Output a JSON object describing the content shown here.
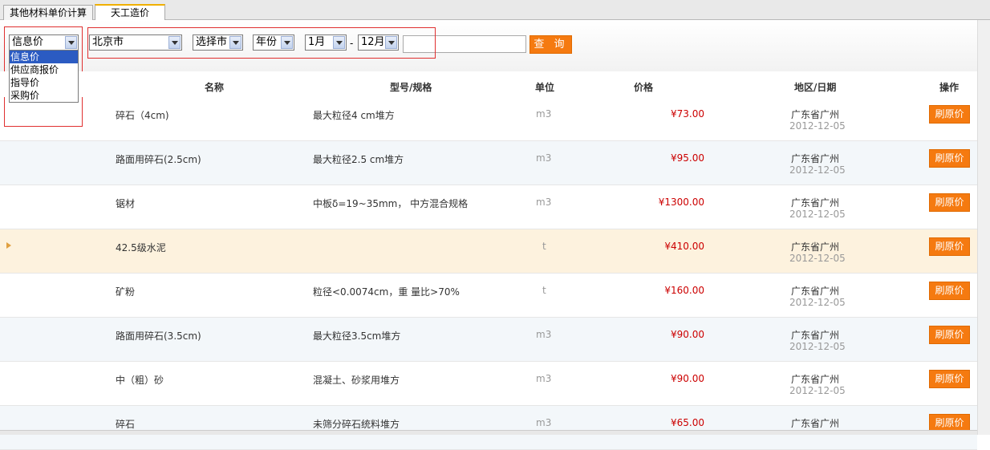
{
  "tabs": [
    {
      "label": "其他材料单价计算"
    },
    {
      "label": "天工造价"
    }
  ],
  "filters": {
    "price_type": {
      "selected": "信息价",
      "options": [
        "信息价",
        "供应商报价",
        "指导价",
        "采购价"
      ]
    },
    "province": {
      "selected": "北京市"
    },
    "city": {
      "selected": "选择市"
    },
    "year": {
      "selected": "年份"
    },
    "month_from": {
      "selected": "1月"
    },
    "month_sep": "-",
    "month_to": {
      "selected": "12月"
    },
    "keyword": {
      "value": ""
    },
    "query_label": "查 询"
  },
  "table": {
    "headers": [
      "名称",
      "型号/规格",
      "单位",
      "价格",
      "地区/日期",
      "操作"
    ],
    "rows": [
      {
        "name": "碎石（4cm)",
        "spec": "最大粒径4 cm堆方",
        "unit": "m3",
        "price": "¥73.00",
        "region": "广东省广州",
        "date": "2012-12-05",
        "action": "刷原价"
      },
      {
        "name": "路面用碎石(2.5cm)",
        "spec": "最大粒径2.5 cm堆方",
        "unit": "m3",
        "price": "¥95.00",
        "region": "广东省广州",
        "date": "2012-12-05",
        "action": "刷原价"
      },
      {
        "name": "锯材",
        "spec": "中板δ=19~35mm， 中方混合规格",
        "unit": "m3",
        "price": "¥1300.00",
        "region": "广东省广州",
        "date": "2012-12-05",
        "action": "刷原价"
      },
      {
        "name": "42.5级水泥",
        "spec": "",
        "unit": "t",
        "price": "¥410.00",
        "region": "广东省广州",
        "date": "2012-12-05",
        "action": "刷原价"
      },
      {
        "name": "矿粉",
        "spec": "粒径<0.0074cm，重 量比>70%",
        "unit": "t",
        "price": "¥160.00",
        "region": "广东省广州",
        "date": "2012-12-05",
        "action": "刷原价"
      },
      {
        "name": "路面用碎石(3.5cm)",
        "spec": "最大粒径3.5cm堆方",
        "unit": "m3",
        "price": "¥90.00",
        "region": "广东省广州",
        "date": "2012-12-05",
        "action": "刷原价"
      },
      {
        "name": "中（粗）砂",
        "spec": "混凝土、砂浆用堆方",
        "unit": "m3",
        "price": "¥90.00",
        "region": "广东省广州",
        "date": "2012-12-05",
        "action": "刷原价"
      },
      {
        "name": "碎石",
        "spec": "未筛分碎石统料堆方",
        "unit": "m3",
        "price": "¥65.00",
        "region": "广东省广州",
        "date": "",
        "action": "刷原价"
      }
    ]
  },
  "colors": {
    "accent": "#f57a10",
    "price": "#cc0000",
    "highlight_row": "#fdf2de"
  }
}
